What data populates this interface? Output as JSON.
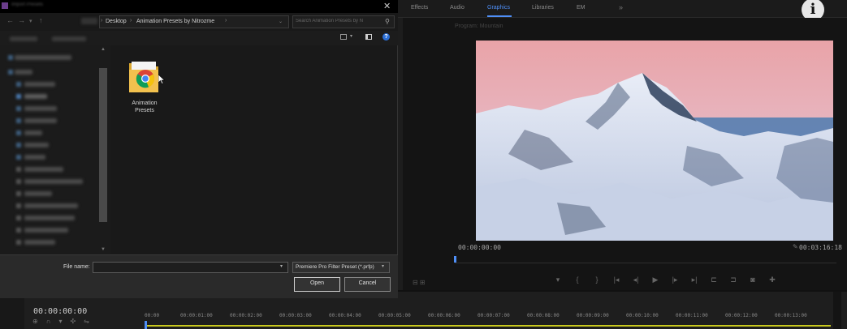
{
  "premiere": {
    "workspace_tabs": [
      "Effects",
      "Audio",
      "Graphics",
      "Libraries",
      "EM"
    ],
    "active_tab": "Graphics",
    "more": "»",
    "program_label": "Program: Mountain",
    "program_timecode_left": "00:00:00:00",
    "program_timecode_right": "00:03:16:18",
    "timeline_timecode": "00:00:00:00",
    "ruler_ticks": [
      "00:00",
      "00:00:01:00",
      "00:00:02:00",
      "00:00:03:00",
      "00:00:04:00",
      "00:00:05:00",
      "00:00:06:00",
      "00:00:07:00",
      "00:00:08:00",
      "00:00:09:00",
      "00:00:10:00",
      "00:00:11:00",
      "00:00:12:00",
      "00:00:13:00"
    ],
    "accent_color": "#4f8ff7",
    "info_glyph": "i"
  },
  "dialog": {
    "title": "Import Presets",
    "close_glyph": "✕",
    "breadcrumb": [
      "Desktop",
      "Animation Presets by Nitrozme"
    ],
    "search_placeholder": "Search Animation Presets by N",
    "folder_name_line1": "Animation",
    "folder_name_line2": "Presets",
    "file_name_label": "File name:",
    "file_name_value": "",
    "file_type": "Premiere Pro Filter Preset (*.prfp)",
    "open_label": "Open",
    "cancel_label": "Cancel",
    "help_glyph": "?"
  }
}
